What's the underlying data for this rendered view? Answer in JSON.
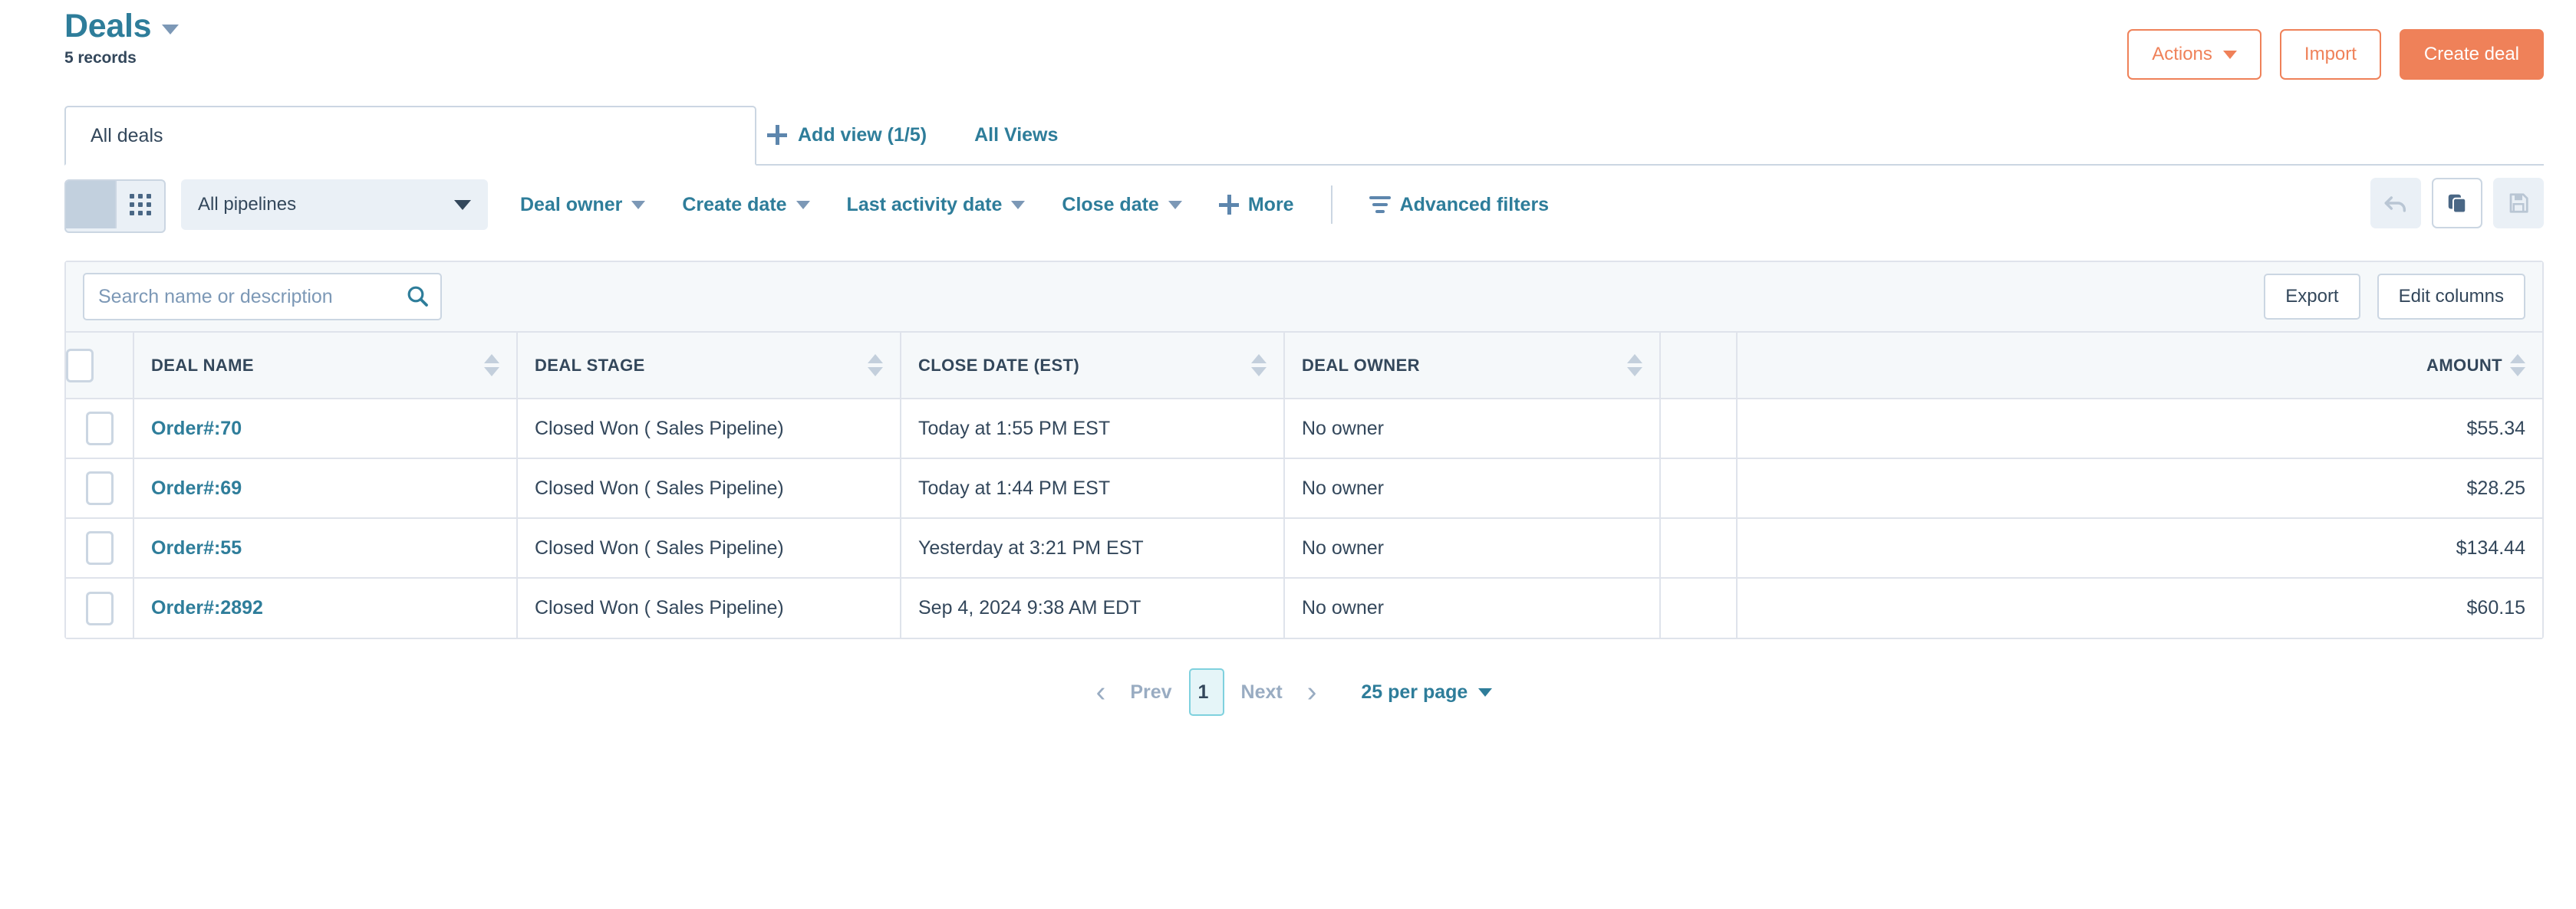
{
  "header": {
    "title": "Deals",
    "record_count": "5 records",
    "title_caret_icon": "chevron-down-icon",
    "actions": {
      "actions_label": "Actions",
      "import_label": "Import",
      "create_label": "Create deal"
    }
  },
  "tabs": {
    "active_tab": "All deals",
    "add_view_label": "Add view (1/5)",
    "add_view_icon": "plus-icon",
    "all_views_label": "All Views"
  },
  "toolbar": {
    "view_list_icon": "list-view-icon",
    "view_grid_icon": "grid-view-icon",
    "pipeline_value": "All pipelines",
    "filters": [
      {
        "label": "Deal owner"
      },
      {
        "label": "Create date"
      },
      {
        "label": "Last activity date"
      },
      {
        "label": "Close date"
      }
    ],
    "more_label": "More",
    "more_icon": "plus-icon",
    "advanced_filters_label": "Advanced filters",
    "advanced_filters_icon": "filter-lines-icon",
    "undo_icon": "undo-arrow-icon",
    "duplicate_icon": "copy-layers-icon",
    "save_icon": "floppy-save-icon"
  },
  "table_toolbar": {
    "search_placeholder": "Search name or description",
    "search_value": "",
    "search_icon": "search-icon",
    "export_label": "Export",
    "edit_columns_label": "Edit columns"
  },
  "table": {
    "columns": [
      {
        "label": "DEAL NAME",
        "align": "left"
      },
      {
        "label": "DEAL STAGE",
        "align": "left"
      },
      {
        "label": "CLOSE DATE (EST)",
        "align": "left"
      },
      {
        "label": "DEAL OWNER",
        "align": "left"
      },
      {
        "label": "",
        "align": "left"
      },
      {
        "label": "AMOUNT",
        "align": "right"
      }
    ],
    "rows": [
      {
        "deal_name": "Order#:70",
        "deal_stage": "Closed Won ( Sales Pipeline)",
        "close_date": "Today at 1:55 PM EST",
        "deal_owner": "No owner",
        "blank": "",
        "amount": "$55.34"
      },
      {
        "deal_name": "Order#:69",
        "deal_stage": "Closed Won ( Sales Pipeline)",
        "close_date": "Today at 1:44 PM EST",
        "deal_owner": "No owner",
        "blank": "",
        "amount": "$28.25"
      },
      {
        "deal_name": "Order#:55",
        "deal_stage": "Closed Won ( Sales Pipeline)",
        "close_date": "Yesterday at 3:21 PM EST",
        "deal_owner": "No owner",
        "blank": "",
        "amount": "$134.44"
      },
      {
        "deal_name": "Order#:2892",
        "deal_stage": "Closed Won ( Sales Pipeline)",
        "close_date": "Sep 4, 2024 9:38 AM EDT",
        "deal_owner": "No owner",
        "blank": "",
        "amount": "$60.15"
      }
    ]
  },
  "pagination": {
    "prev_label": "Prev",
    "next_label": "Next",
    "current_page": "1",
    "per_page_label": "25 per page",
    "prev_arrow_icon": "chevron-left-icon",
    "next_arrow_icon": "chevron-right-icon"
  },
  "colors": {
    "brand_teal": "#2e7d9a",
    "accent_orange": "#ef8159",
    "text_dark": "#33475b",
    "border": "#dfe3eb",
    "panel_bg": "#f5f8fa"
  }
}
